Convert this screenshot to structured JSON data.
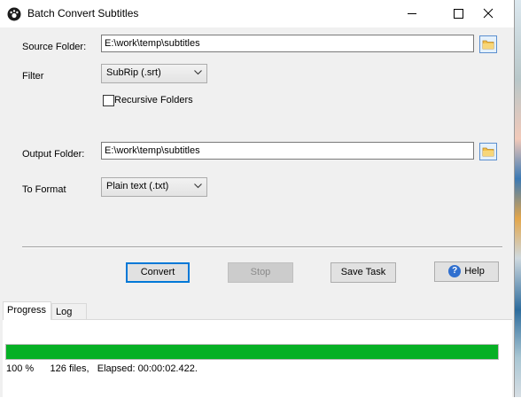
{
  "window": {
    "title": "Batch Convert Subtitles"
  },
  "source_folder": {
    "label": "Source Folder:",
    "value": "E:\\work\\temp\\subtitles"
  },
  "filter": {
    "label": "Filter",
    "selected": "SubRip (.srt)"
  },
  "recursive": {
    "label": "Recursive Folders",
    "checked": false
  },
  "output_folder": {
    "label": "Output Folder:",
    "value": "E:\\work\\temp\\subtitles"
  },
  "to_format": {
    "label": "To Format",
    "selected": "Plain text (.txt)"
  },
  "buttons": {
    "convert": "Convert",
    "stop": "Stop",
    "save_task": "Save Task",
    "help": "Help"
  },
  "tabs": [
    {
      "label": "Progress",
      "active": true
    },
    {
      "label": "Log",
      "active": false
    }
  ],
  "progress": {
    "fraction": 1.0,
    "percent_text": "100 %",
    "files_text": "126 files,",
    "elapsed_text": "Elapsed: 00:00:02.422."
  },
  "colors": {
    "progress_fill": "#06b025",
    "accent": "#0078d7"
  }
}
